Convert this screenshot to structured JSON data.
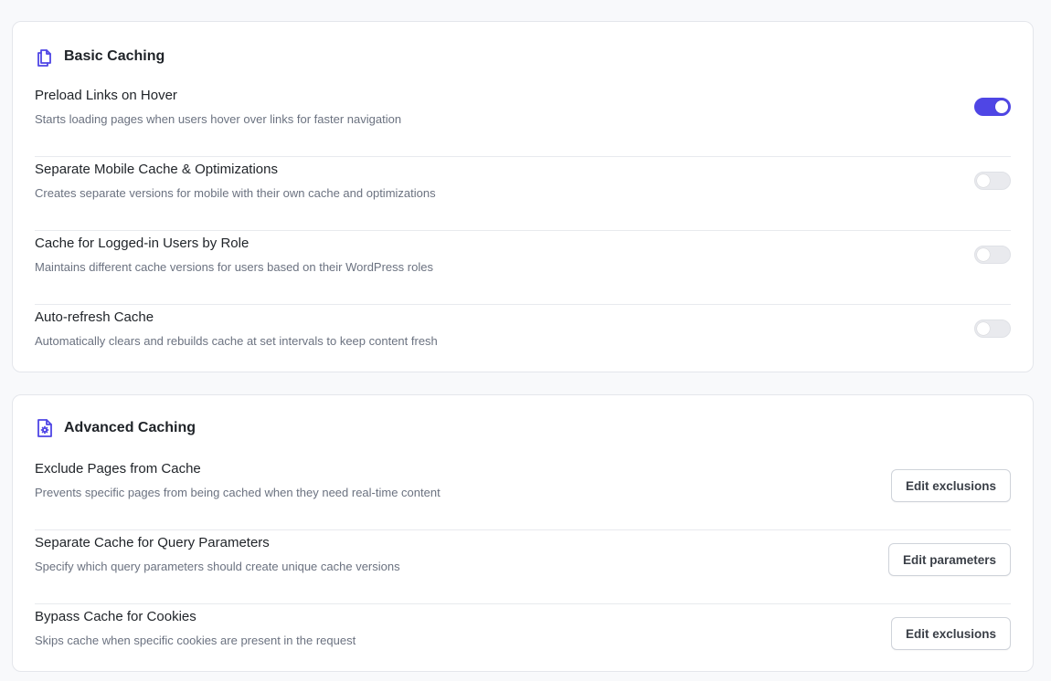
{
  "colors": {
    "accent": "#4f46e5",
    "toggle_off": "#e9eaee"
  },
  "basic": {
    "icon": "copy-icon",
    "title": "Basic Caching",
    "rows": [
      {
        "title": "Preload Links on Hover",
        "description": "Starts loading pages when users hover over links for faster navigation",
        "enabled": true
      },
      {
        "title": "Separate Mobile Cache & Optimizations",
        "description": "Creates separate versions for mobile with their own cache and optimizations",
        "enabled": false
      },
      {
        "title": "Cache for Logged-in Users by Role",
        "description": "Maintains different cache versions for users based on their WordPress roles",
        "enabled": false
      },
      {
        "title": "Auto-refresh Cache",
        "description": "Automatically clears and rebuilds cache at set intervals to keep content fresh",
        "enabled": false
      }
    ]
  },
  "advanced": {
    "icon": "file-settings-icon",
    "title": "Advanced Caching",
    "rows": [
      {
        "title": "Exclude Pages from Cache",
        "description": "Prevents specific pages from being cached when they need real-time content",
        "button_label": "Edit exclusions"
      },
      {
        "title": "Separate Cache for Query Parameters",
        "description": "Specify which query parameters should create unique cache versions",
        "button_label": "Edit parameters"
      },
      {
        "title": "Bypass Cache for Cookies",
        "description": "Skips cache when specific cookies are present in the request",
        "button_label": "Edit exclusions"
      }
    ]
  }
}
